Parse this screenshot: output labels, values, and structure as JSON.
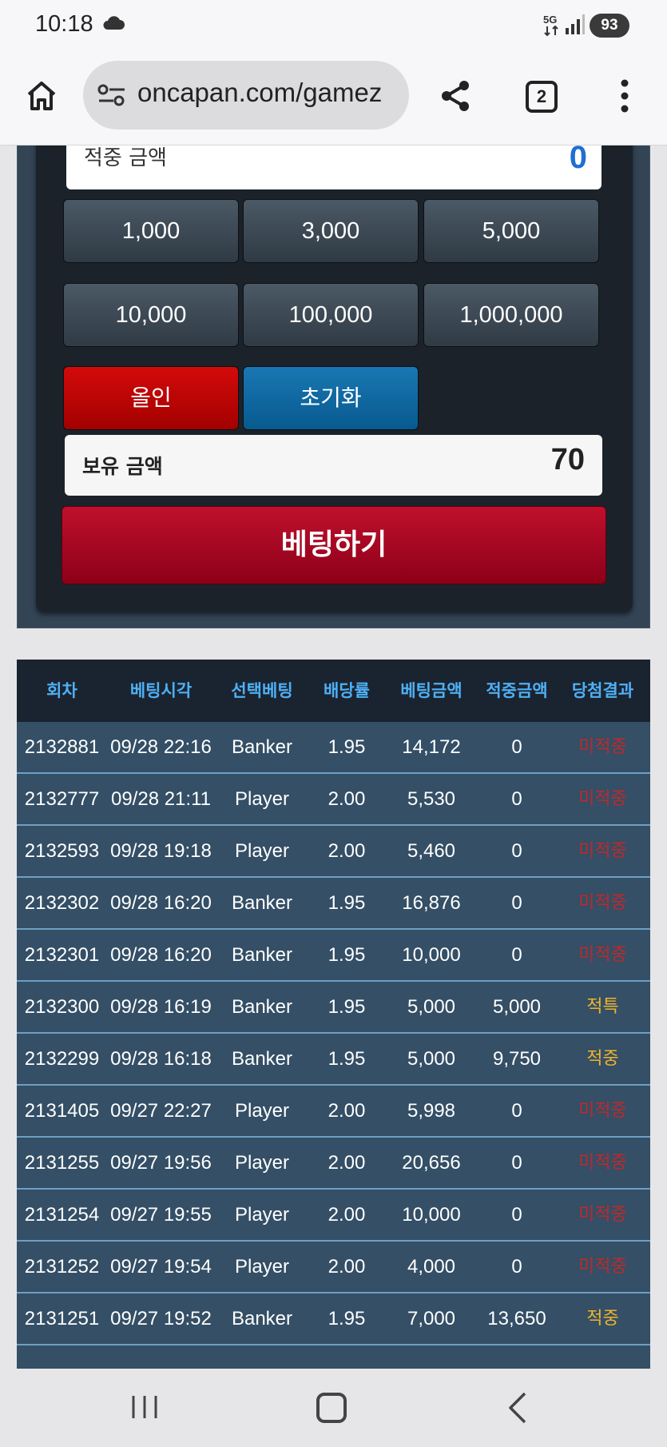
{
  "status": {
    "time": "10:18",
    "battery": "93",
    "network": "5G"
  },
  "browser": {
    "url": "oncapan.com/gamez",
    "tab_count": "2"
  },
  "bet_panel": {
    "win_label": "적중 금액",
    "win_value": "0",
    "chips": [
      "1,000",
      "3,000",
      "5,000",
      "10,000",
      "100,000",
      "1,000,000"
    ],
    "allin_label": "올인",
    "reset_label": "초기화",
    "balance_label": "보유 금액",
    "balance_value": "70",
    "bet_button_label": "베팅하기"
  },
  "history": {
    "headers": [
      "회차",
      "베팅시각",
      "선택베팅",
      "배당률",
      "베팅금액",
      "적중금액",
      "당첨결과"
    ],
    "rows": [
      [
        "2132881",
        "09/28 22:16",
        "Banker",
        "1.95",
        "14,172",
        "0",
        "미적중"
      ],
      [
        "2132777",
        "09/28 21:11",
        "Player",
        "2.00",
        "5,530",
        "0",
        "미적중"
      ],
      [
        "2132593",
        "09/28 19:18",
        "Player",
        "2.00",
        "5,460",
        "0",
        "미적중"
      ],
      [
        "2132302",
        "09/28 16:20",
        "Banker",
        "1.95",
        "16,876",
        "0",
        "미적중"
      ],
      [
        "2132301",
        "09/28 16:20",
        "Banker",
        "1.95",
        "10,000",
        "0",
        "미적중"
      ],
      [
        "2132300",
        "09/28 16:19",
        "Banker",
        "1.95",
        "5,000",
        "5,000",
        "적특"
      ],
      [
        "2132299",
        "09/28 16:18",
        "Banker",
        "1.95",
        "5,000",
        "9,750",
        "적중"
      ],
      [
        "2131405",
        "09/27 22:27",
        "Player",
        "2.00",
        "5,998",
        "0",
        "미적중"
      ],
      [
        "2131255",
        "09/27 19:56",
        "Player",
        "2.00",
        "20,656",
        "0",
        "미적중"
      ],
      [
        "2131254",
        "09/27 19:55",
        "Player",
        "2.00",
        "10,000",
        "0",
        "미적중"
      ],
      [
        "2131252",
        "09/27 19:54",
        "Player",
        "2.00",
        "4,000",
        "0",
        "미적중"
      ],
      [
        "2131251",
        "09/27 19:52",
        "Banker",
        "1.95",
        "7,000",
        "13,650",
        "적중"
      ]
    ],
    "colors": {
      "miss": "#c0282a",
      "hit": "#f0b429"
    }
  }
}
